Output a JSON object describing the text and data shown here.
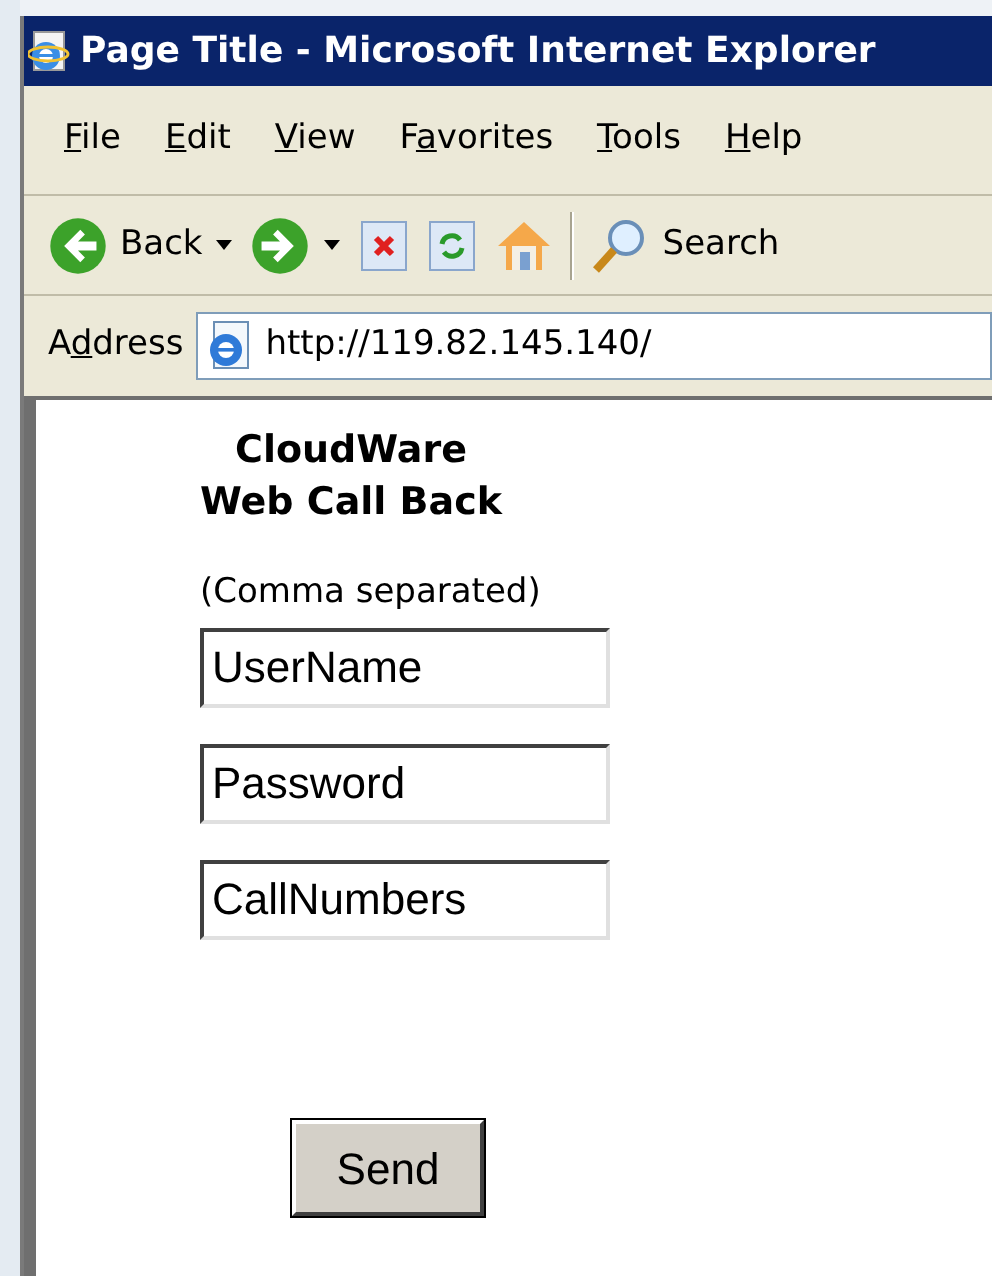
{
  "window": {
    "title": "Page Title - Microsoft Internet Explorer"
  },
  "menu": [
    {
      "key": "F",
      "rest": "ile"
    },
    {
      "key": "E",
      "rest": "dit"
    },
    {
      "key": "V",
      "rest": "iew"
    },
    {
      "lead": "F",
      "key": "a",
      "rest": "vorites"
    },
    {
      "key": "T",
      "rest": "ools"
    },
    {
      "key": "H",
      "rest": "elp"
    }
  ],
  "toolbar": [
    {
      "kind": "back",
      "label": "Back"
    },
    {
      "kind": "forward"
    },
    {
      "kind": "stop"
    },
    {
      "kind": "refresh"
    },
    {
      "kind": "home"
    },
    {
      "kind": "separator"
    },
    {
      "kind": "search",
      "label": "Search"
    }
  ],
  "address_bar": {
    "label": {
      "lead": "A",
      "key": "d",
      "rest": "dress"
    },
    "url": "http://119.82.145.140/"
  },
  "page": {
    "heading": [
      "CloudWare",
      "Web Call Back"
    ],
    "note": "(Comma separated)",
    "fields": [
      {
        "value": "UserName"
      },
      {
        "value": "Password"
      },
      {
        "value": "CallNumbers"
      }
    ],
    "button": "Send"
  }
}
